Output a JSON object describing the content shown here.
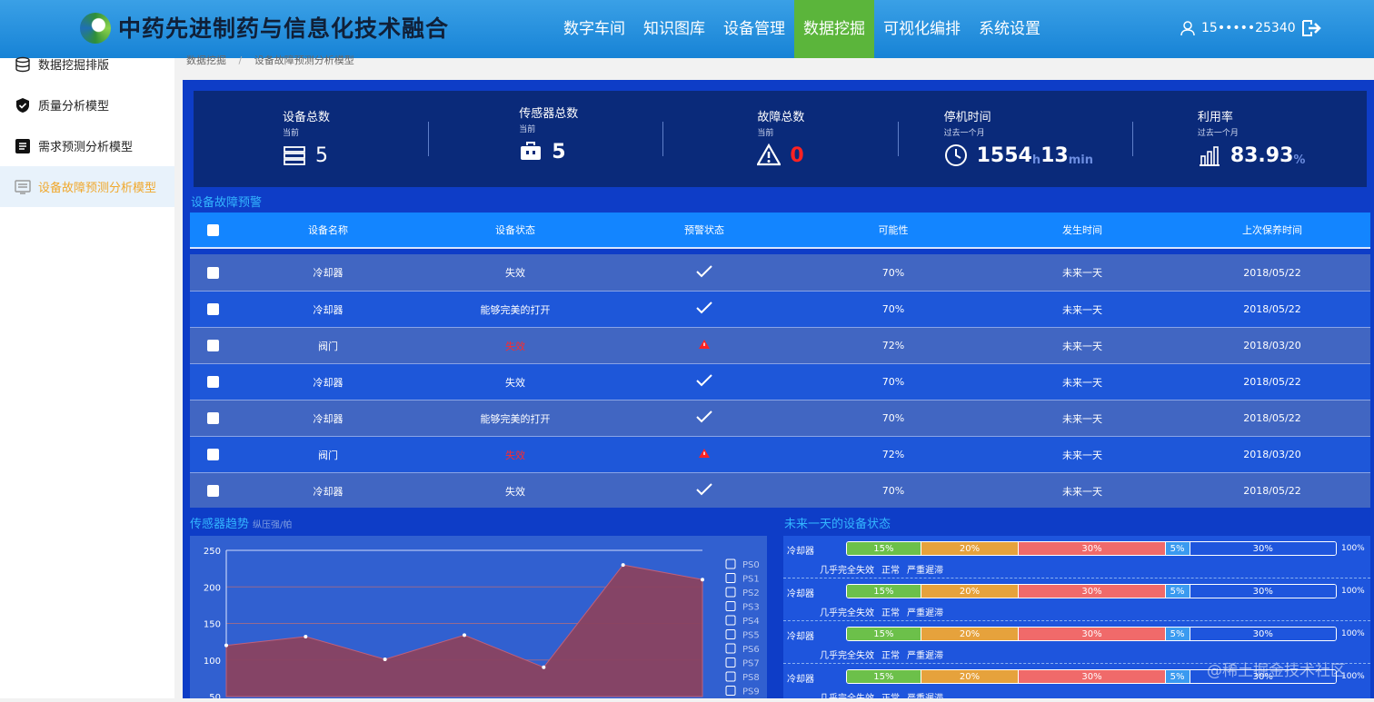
{
  "header": {
    "title": "中药先进制药与信息化技术融合",
    "nav": [
      "数字车间",
      "知识图库",
      "设备管理",
      "数据挖掘",
      "可视化编排",
      "系统设置"
    ],
    "active_nav": 3,
    "user": "15•••••25340"
  },
  "sidebar": {
    "items": [
      {
        "label": "数据挖掘排版",
        "icon": "database-icon"
      },
      {
        "label": "质量分析模型",
        "icon": "shield-check-icon"
      },
      {
        "label": "需求预测分析模型",
        "icon": "document-icon"
      },
      {
        "label": "设备故障预测分析模型",
        "icon": "monitor-icon"
      }
    ],
    "active": 3
  },
  "breadcrumb": {
    "root": "数据挖掘",
    "sep": "/",
    "current": "设备故障预测分析模型"
  },
  "stats": [
    {
      "title": "设备总数",
      "sub": "当前",
      "value": "5",
      "icon": "list-icon"
    },
    {
      "title": "传感器总数",
      "sub": "当前",
      "value": "5",
      "icon": "toolbox-icon"
    },
    {
      "title": "故障总数",
      "sub": "当前",
      "value": "0",
      "icon": "warning-icon"
    },
    {
      "title": "停机时间",
      "sub": "过去一个月",
      "value": "1554",
      "unit1": "h",
      "value2": "13",
      "unit2": "min",
      "icon": "clock-icon"
    },
    {
      "title": "利用率",
      "sub": "过去一个月",
      "value": "83.93",
      "unit1": "%",
      "icon": "bar-chart-icon"
    }
  ],
  "alerts": {
    "title": "设备故障预警",
    "columns": [
      "设备名称",
      "设备状态",
      "预警状态",
      "可能性",
      "发生时间",
      "上次保养时间"
    ],
    "rows": [
      {
        "name": "冷却器",
        "status": "失效",
        "warn": false,
        "prob": "70%",
        "time": "未来一天",
        "maint": "2018/05/22"
      },
      {
        "name": "冷却器",
        "status": "能够完美的打开",
        "warn": false,
        "prob": "70%",
        "time": "未来一天",
        "maint": "2018/05/22"
      },
      {
        "name": "阀门",
        "status": "失效",
        "warn": true,
        "prob": "72%",
        "time": "未来一天",
        "maint": "2018/03/20"
      },
      {
        "name": "冷却器",
        "status": "失效",
        "warn": false,
        "prob": "70%",
        "time": "未来一天",
        "maint": "2018/05/22"
      },
      {
        "name": "冷却器",
        "status": "能够完美的打开",
        "warn": false,
        "prob": "70%",
        "time": "未来一天",
        "maint": "2018/05/22"
      },
      {
        "name": "阀门",
        "status": "失效",
        "warn": true,
        "prob": "72%",
        "time": "未来一天",
        "maint": "2018/03/20"
      },
      {
        "name": "冷却器",
        "status": "失效",
        "warn": false,
        "prob": "70%",
        "time": "未来一天",
        "maint": "2018/05/22"
      }
    ]
  },
  "trend": {
    "title": "传感器趋势",
    "subtitle": "纵压强/帕",
    "legend": [
      "PS0",
      "PS1",
      "PS2",
      "PS3",
      "PS4",
      "PS5",
      "PS6",
      "PS7",
      "PS8",
      "PS9"
    ]
  },
  "chart_data": {
    "type": "area",
    "x": [
      0,
      1,
      2,
      3,
      4,
      5,
      6
    ],
    "series": [
      {
        "values": [
          120,
          132,
          101,
          134,
          90,
          230,
          210
        ]
      }
    ],
    "ylim": [
      50,
      250
    ],
    "yticks": [
      "250",
      "200",
      "150",
      "100",
      "50"
    ]
  },
  "device_status": {
    "title": "未来一天的设备状态",
    "rows": [
      {
        "name": "冷却器",
        "total": "100%",
        "segments": [
          {
            "label": "15%",
            "pct": 15,
            "color": "#6cc04a"
          },
          {
            "label": "20%",
            "pct": 20,
            "color": "#e6a23c"
          },
          {
            "label": "30%",
            "pct": 30,
            "color": "#f06a6a"
          },
          {
            "label": "5%",
            "pct": 5,
            "color": "#3a9af0"
          },
          {
            "label": "30%",
            "pct": 30,
            "color": "#1e55dd"
          }
        ],
        "legend": [
          "几乎完全失效",
          "正常",
          "严重遲滞"
        ]
      },
      {
        "name": "冷却器",
        "total": "100%",
        "segments": [
          {
            "label": "15%",
            "pct": 15,
            "color": "#6cc04a"
          },
          {
            "label": "20%",
            "pct": 20,
            "color": "#e6a23c"
          },
          {
            "label": "30%",
            "pct": 30,
            "color": "#f06a6a"
          },
          {
            "label": "5%",
            "pct": 5,
            "color": "#3a9af0"
          },
          {
            "label": "30%",
            "pct": 30,
            "color": "#1e55dd"
          }
        ],
        "legend": [
          "几乎完全失效",
          "正常",
          "严重遲滞"
        ]
      },
      {
        "name": "冷却器",
        "total": "100%",
        "segments": [
          {
            "label": "15%",
            "pct": 15,
            "color": "#6cc04a"
          },
          {
            "label": "20%",
            "pct": 20,
            "color": "#e6a23c"
          },
          {
            "label": "30%",
            "pct": 30,
            "color": "#f06a6a"
          },
          {
            "label": "5%",
            "pct": 5,
            "color": "#3a9af0"
          },
          {
            "label": "30%",
            "pct": 30,
            "color": "#1e55dd"
          }
        ],
        "legend": [
          "几乎完全失效",
          "正常",
          "严重遲滞"
        ]
      },
      {
        "name": "冷却器",
        "total": "100%",
        "segments": [
          {
            "label": "15%",
            "pct": 15,
            "color": "#6cc04a"
          },
          {
            "label": "20%",
            "pct": 20,
            "color": "#e6a23c"
          },
          {
            "label": "30%",
            "pct": 30,
            "color": "#f06a6a"
          },
          {
            "label": "5%",
            "pct": 5,
            "color": "#3a9af0"
          },
          {
            "label": "30%",
            "pct": 30,
            "color": "#1e55dd"
          }
        ],
        "legend": [
          "几乎完全失效",
          "正常",
          "严重遲滞"
        ]
      }
    ]
  },
  "watermark": "@稀土掘金技术社区"
}
